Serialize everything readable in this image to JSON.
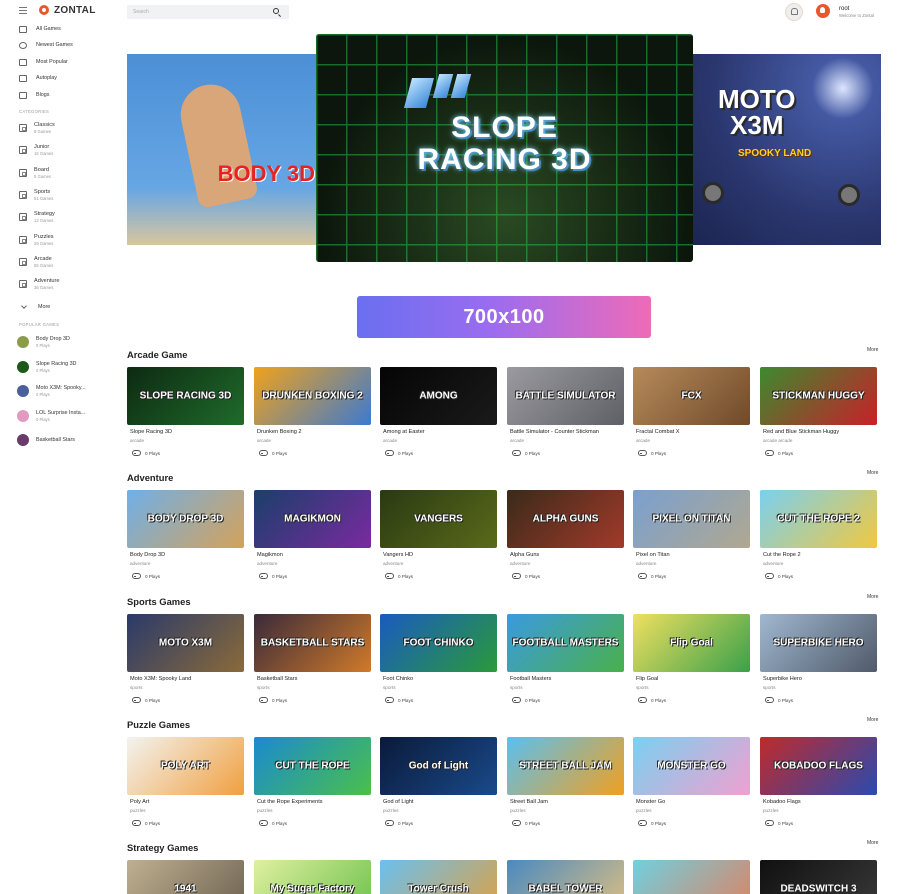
{
  "brand": {
    "name": "ZONTAL"
  },
  "sidebar": {
    "nav": [
      {
        "label": "All Games",
        "icon": "grid-icon"
      },
      {
        "label": "Newest Games",
        "icon": "sparkle-icon"
      },
      {
        "label": "Most Popular",
        "icon": "star-icon"
      },
      {
        "label": "Autoplay",
        "icon": "gamepad-icon"
      },
      {
        "label": "Blogs",
        "icon": "document-icon"
      }
    ],
    "categories_label": "CATEGORIES",
    "categories": [
      {
        "name": "Classics",
        "count": "8 Games"
      },
      {
        "name": "Junior",
        "count": "16 Games"
      },
      {
        "name": "Board",
        "count": "5 Games"
      },
      {
        "name": "Sports",
        "count": "51 Games"
      },
      {
        "name": "Strategy",
        "count": "12 Games"
      },
      {
        "name": "Puzzles",
        "count": "29 Games"
      },
      {
        "name": "Arcade",
        "count": "55 Games"
      },
      {
        "name": "Adventure",
        "count": "36 Games"
      }
    ],
    "more_label": "More",
    "popular_label": "POPULAR GAMES",
    "popular": [
      {
        "name": "Body Drop 3D",
        "plays": "0 Plays",
        "color": "#8a9b4a"
      },
      {
        "name": "Slope Racing 3D",
        "plays": "0 Plays",
        "color": "#1d5a1a"
      },
      {
        "name": "Moto X3M: Spooky...",
        "plays": "0 Plays",
        "color": "#4a5f9e"
      },
      {
        "name": "LOL Surprise Insta...",
        "plays": "0 Plays",
        "color": "#e39ac1"
      },
      {
        "name": "Basketball Stars",
        "plays": "",
        "color": "#6a3a6a"
      }
    ]
  },
  "header": {
    "search_placeholder": "Search",
    "user": {
      "name": "root",
      "subtitle": "Welcome to Zontal"
    }
  },
  "carousel": {
    "left_title": "BODY 3D",
    "center_title": "SLOPE\nRACING 3D",
    "right_title": "MOTO\nX3M",
    "right_subtitle": "SPOOKY LAND"
  },
  "ad": {
    "text": "700x100"
  },
  "sections": [
    {
      "title": "Arcade Game",
      "more": "More",
      "games": [
        {
          "title": "Slope Racing 3D",
          "category": "arcade",
          "plays": "0 Plays",
          "art": "SLOPE RACING 3D",
          "bg": "#0d2a12",
          "bg2": "#1f6b2a"
        },
        {
          "title": "Drunken Boxing 2",
          "category": "arcade",
          "plays": "0 Plays",
          "art": "DRUNKEN BOXING 2",
          "bg": "#f0a21a",
          "bg2": "#3d7ad0"
        },
        {
          "title": "Among at Easter",
          "category": "arcade",
          "plays": "0 Plays",
          "art": "AMONG",
          "bg": "#050505",
          "bg2": "#1a1a1a"
        },
        {
          "title": "Battle Simulator - Counter Stickman",
          "category": "arcade",
          "plays": "0 Plays",
          "art": "BATTLE SIMULATOR",
          "bg": "#9a9aa0",
          "bg2": "#5f5f66"
        },
        {
          "title": "Fractal Combat X",
          "category": "arcade",
          "plays": "0 Plays",
          "art": "FCX",
          "bg": "#b78a5a",
          "bg2": "#6f4a2a"
        },
        {
          "title": "Red and Blue Stickman Huggy",
          "category": "arcade arcade",
          "plays": "0 Plays",
          "art": "STICKMAN HUGGY",
          "bg": "#3c8a2e",
          "bg2": "#c8202a"
        }
      ]
    },
    {
      "title": "Adventure",
      "more": "More",
      "games": [
        {
          "title": "Body Drop 3D",
          "category": "adventure",
          "plays": "0 Plays",
          "art": "BODY DROP 3D",
          "bg": "#6fb0e8",
          "bg2": "#d4a25a"
        },
        {
          "title": "Magikmon",
          "category": "adventure",
          "plays": "0 Plays",
          "art": "MAGIKMON",
          "bg": "#1a3f6a",
          "bg2": "#7a2aa0"
        },
        {
          "title": "Vangers HD",
          "category": "adventure",
          "plays": "0 Plays",
          "art": "VANGERS",
          "bg": "#2a3a12",
          "bg2": "#5a6a1a"
        },
        {
          "title": "Alpha Guns",
          "category": "adventure",
          "plays": "0 Plays",
          "art": "ALPHA GUNS",
          "bg": "#3a2a1a",
          "bg2": "#a23a2a"
        },
        {
          "title": "Pixel on Titan",
          "category": "adventure",
          "plays": "0 Plays",
          "art": "PIXEL ON TITAN",
          "bg": "#7aa0d0",
          "bg2": "#b0a890"
        },
        {
          "title": "Cut the Rope 2",
          "category": "adventure",
          "plays": "0 Plays",
          "art": "CUT THE ROPE 2",
          "bg": "#7ad0f0",
          "bg2": "#f0c840"
        }
      ]
    },
    {
      "title": "Sports Games",
      "more": "More",
      "games": [
        {
          "title": "Moto X3M: Spooky Land",
          "category": "sports",
          "plays": "0 Plays",
          "art": "MOTO X3M",
          "bg": "#2a3a6a",
          "bg2": "#8a6a3a"
        },
        {
          "title": "Basketball Stars",
          "category": "sports",
          "plays": "0 Plays",
          "art": "BASKETBALL STARS",
          "bg": "#3a2a3a",
          "bg2": "#d07a2a"
        },
        {
          "title": "Foot Chinko",
          "category": "sports",
          "plays": "0 Plays",
          "art": "FOOT CHINKO",
          "bg": "#1a5ac0",
          "bg2": "#2a9a3a"
        },
        {
          "title": "Football Masters",
          "category": "sports",
          "plays": "0 Plays",
          "art": "FOOTBALL MASTERS",
          "bg": "#3a9ae0",
          "bg2": "#4ab04a"
        },
        {
          "title": "Flip Goal",
          "category": "sports",
          "plays": "0 Plays",
          "art": "Flip Goal",
          "bg": "#f0e060",
          "bg2": "#3aa04a"
        },
        {
          "title": "Superbike Hero",
          "category": "sports",
          "plays": "0 Plays",
          "art": "SUPERBIKE HERO",
          "bg": "#a0b8d0",
          "bg2": "#505a6a"
        }
      ]
    },
    {
      "title": "Puzzle Games",
      "more": "More",
      "games": [
        {
          "title": "Poly Art",
          "category": "puzzles",
          "plays": "0 Plays",
          "art": "POLY ART",
          "bg": "#f3f3f0",
          "bg2": "#f0a040"
        },
        {
          "title": "Cut the Rope Experiments",
          "category": "puzzles",
          "plays": "0 Plays",
          "art": "CUT THE ROPE",
          "bg": "#1a8ad0",
          "bg2": "#4ac04a"
        },
        {
          "title": "God of Light",
          "category": "puzzles",
          "plays": "0 Plays",
          "art": "God of Light",
          "bg": "#0a1a3a",
          "bg2": "#1a4a8a"
        },
        {
          "title": "Street Ball Jam",
          "category": "puzzles",
          "plays": "0 Plays",
          "art": "STREET BALL JAM",
          "bg": "#5ac0f0",
          "bg2": "#f0a020"
        },
        {
          "title": "Monster Go",
          "category": "puzzles",
          "plays": "0 Plays",
          "art": "MONSTER GO",
          "bg": "#7ad0f0",
          "bg2": "#f0a0d0"
        },
        {
          "title": "Kobadoo Flags",
          "category": "puzzles",
          "plays": "0 Plays",
          "art": "KOBADOO FLAGS",
          "bg": "#c02a2a",
          "bg2": "#2a4ab0"
        }
      ]
    },
    {
      "title": "Strategy Games",
      "more": "More",
      "games": [
        {
          "title": "",
          "category": "",
          "plays": "",
          "art": "1941",
          "bg": "#c0b090",
          "bg2": "#6a6050"
        },
        {
          "title": "",
          "category": "",
          "plays": "",
          "art": "My Sugar Factory",
          "bg": "#e0f0a0",
          "bg2": "#6ac04a"
        },
        {
          "title": "",
          "category": "",
          "plays": "",
          "art": "Tower Crush",
          "bg": "#6ac0f0",
          "bg2": "#e0a040"
        },
        {
          "title": "",
          "category": "",
          "plays": "",
          "art": "BABEL TOWER",
          "bg": "#4a8ac0",
          "bg2": "#e0c080"
        },
        {
          "title": "",
          "category": "",
          "plays": "",
          "art": "",
          "bg": "#70d0e0",
          "bg2": "#e08060"
        },
        {
          "title": "",
          "category": "",
          "plays": "",
          "art": "DEADSWITCH 3",
          "bg": "#101010",
          "bg2": "#3a3a3a"
        }
      ]
    }
  ]
}
